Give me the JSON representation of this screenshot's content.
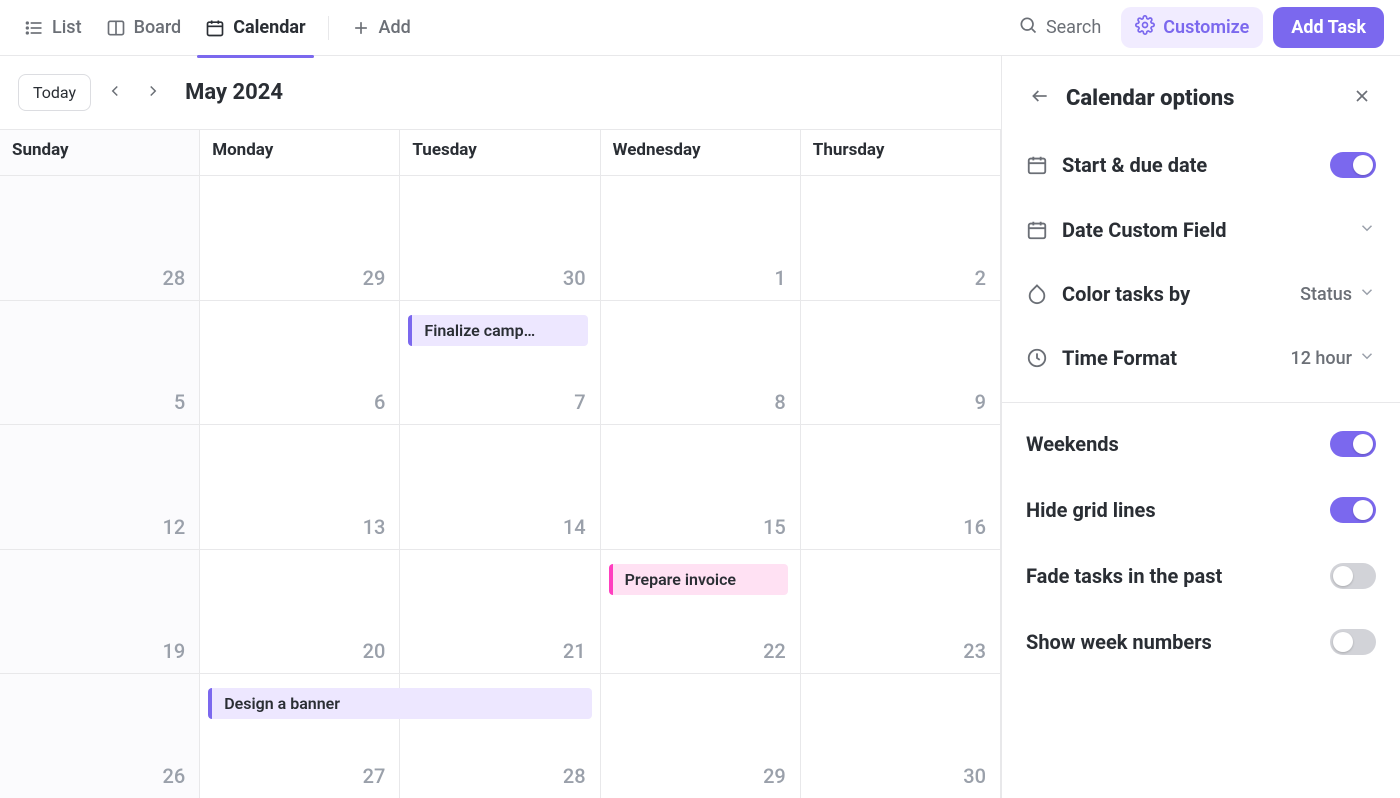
{
  "colors": {
    "accent": "#7b68ee",
    "pink": "#ff3ebf"
  },
  "topbar": {
    "tabs": [
      {
        "label": "List",
        "icon": "list-icon",
        "active": false
      },
      {
        "label": "Board",
        "icon": "board-icon",
        "active": false
      },
      {
        "label": "Calendar",
        "icon": "calendar-icon",
        "active": true
      }
    ],
    "add_label": "Add",
    "search_label": "Search",
    "customize_label": "Customize",
    "add_task_label": "Add Task"
  },
  "calendar": {
    "today_label": "Today",
    "title": "May 2024",
    "days_of_week": [
      "Sunday",
      "Monday",
      "Tuesday",
      "Wednesday",
      "Thursday"
    ],
    "weeks": [
      [
        {
          "d": 28,
          "mute": true
        },
        {
          "d": 29,
          "mute": false
        },
        {
          "d": 30,
          "mute": false
        },
        {
          "d": 1,
          "mute": false
        },
        {
          "d": 2,
          "mute": false
        }
      ],
      [
        {
          "d": 5,
          "mute": true
        },
        {
          "d": 6,
          "mute": false
        },
        {
          "d": 7,
          "mute": false
        },
        {
          "d": 8,
          "mute": false
        },
        {
          "d": 9,
          "mute": false
        }
      ],
      [
        {
          "d": 12,
          "mute": true
        },
        {
          "d": 13,
          "mute": false
        },
        {
          "d": 14,
          "mute": false
        },
        {
          "d": 15,
          "mute": false
        },
        {
          "d": 16,
          "mute": false
        }
      ],
      [
        {
          "d": 19,
          "mute": true
        },
        {
          "d": 20,
          "mute": false
        },
        {
          "d": 21,
          "mute": false
        },
        {
          "d": 22,
          "mute": false
        },
        {
          "d": 23,
          "mute": false
        }
      ],
      [
        {
          "d": 26,
          "mute": true
        },
        {
          "d": 27,
          "mute": false
        },
        {
          "d": 28,
          "mute": false
        },
        {
          "d": 29,
          "mute": false
        },
        {
          "d": 30,
          "mute": false
        }
      ]
    ],
    "tasks": [
      {
        "label": "Finalize camp…",
        "row": 1,
        "col": 2,
        "span": 1,
        "color": "purple"
      },
      {
        "label": "Prepare invoice",
        "row": 3,
        "col": 3,
        "span": 1,
        "color": "pink"
      },
      {
        "label": "Design a banner",
        "row": 4,
        "col": 1,
        "span": 2,
        "color": "purple"
      }
    ]
  },
  "panel": {
    "title": "Calendar options",
    "options": {
      "start_due": {
        "label": "Start & due date",
        "on": true
      },
      "date_cf": {
        "label": "Date Custom Field"
      },
      "color_by": {
        "label": "Color tasks by",
        "value": "Status"
      },
      "time_fmt": {
        "label": "Time Format",
        "value": "12 hour"
      },
      "weekends": {
        "label": "Weekends",
        "on": true
      },
      "hide_grid": {
        "label": "Hide grid lines",
        "on": true
      },
      "fade_past": {
        "label": "Fade tasks in the past",
        "on": false
      },
      "week_nums": {
        "label": "Show week numbers",
        "on": false
      }
    }
  }
}
